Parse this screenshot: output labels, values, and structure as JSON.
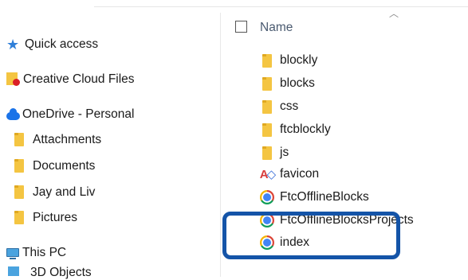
{
  "nav": {
    "items": [
      {
        "label": "Quick access",
        "icon": "star-icon"
      },
      {
        "label": "Creative Cloud Files",
        "icon": "creative-cloud-folder-icon"
      },
      {
        "label": "OneDrive - Personal",
        "icon": "cloud-icon"
      },
      {
        "label": "Attachments",
        "icon": "folder-icon"
      },
      {
        "label": "Documents",
        "icon": "folder-icon"
      },
      {
        "label": "Jay and Liv",
        "icon": "folder-icon"
      },
      {
        "label": "Pictures",
        "icon": "folder-icon"
      },
      {
        "label": "This PC",
        "icon": "computer-icon"
      },
      {
        "label": "3D Objects",
        "icon": "3d-objects-icon"
      }
    ]
  },
  "header": {
    "name_label": "Name"
  },
  "files": [
    {
      "name": "blockly",
      "icon": "folder-icon"
    },
    {
      "name": "blocks",
      "icon": "folder-icon"
    },
    {
      "name": "css",
      "icon": "folder-icon"
    },
    {
      "name": "ftcblockly",
      "icon": "folder-icon"
    },
    {
      "name": "js",
      "icon": "folder-icon"
    },
    {
      "name": "favicon",
      "icon": "favicon-icon"
    },
    {
      "name": "FtcOfflineBlocks",
      "icon": "chrome-icon"
    },
    {
      "name": "FtcOfflineBlocksProjects",
      "icon": "chrome-icon"
    },
    {
      "name": "index",
      "icon": "chrome-icon"
    }
  ],
  "colors": {
    "highlight_border": "#1454a8",
    "folder": "#f4c542",
    "header_text": "#4a5a70"
  }
}
